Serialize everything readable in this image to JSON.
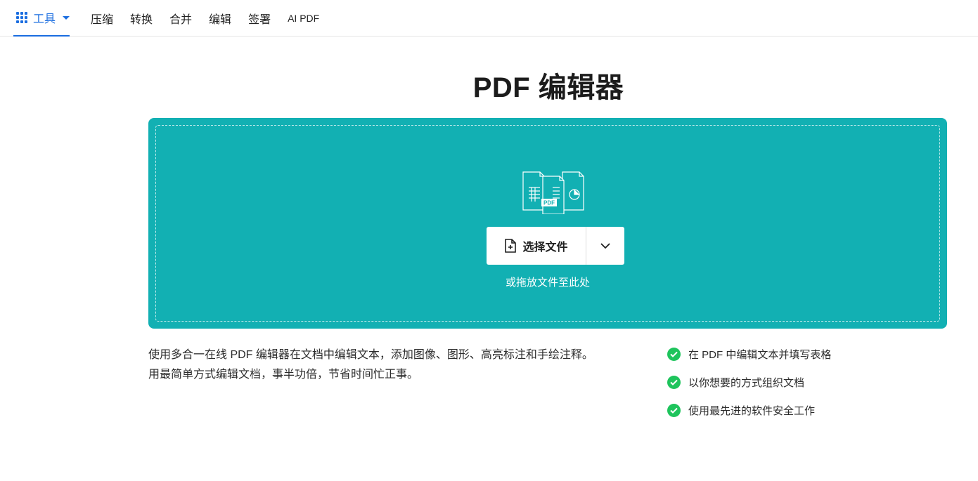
{
  "nav": {
    "tools_label": "工具",
    "items": [
      {
        "label": "压缩"
      },
      {
        "label": "转换"
      },
      {
        "label": "合并"
      },
      {
        "label": "编辑"
      },
      {
        "label": "签署"
      },
      {
        "label": "AI PDF"
      }
    ]
  },
  "page": {
    "title": "PDF 编辑器"
  },
  "upload": {
    "select_label": "选择文件",
    "drop_hint": "或拖放文件至此处",
    "icon_badge": "PDF"
  },
  "description": "使用多合一在线 PDF 编辑器在文档中编辑文本，添加图像、图形、高亮标注和手绘注释。用最简单方式编辑文档，事半功倍，节省时间忙正事。",
  "features": [
    {
      "text": "在 PDF 中编辑文本并填写表格"
    },
    {
      "text": "以你想要的方式组织文档"
    },
    {
      "text": "使用最先进的软件安全工作"
    }
  ],
  "colors": {
    "accent": "#1a6de0",
    "dropzone": "#12b0b3",
    "check": "#1ec45c"
  }
}
